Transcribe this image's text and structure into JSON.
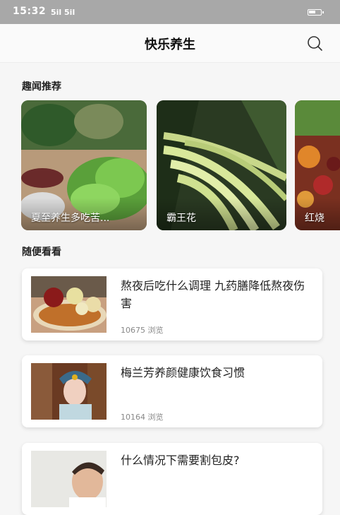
{
  "status_bar": {
    "time": "15:32",
    "signal": "5il 5il"
  },
  "header": {
    "title": "快乐养生"
  },
  "section_featured": {
    "title": "趣闻推荐"
  },
  "featured": [
    {
      "label": "夏至养生多吃苦..."
    },
    {
      "label": "霸王花"
    },
    {
      "label": "红烧"
    }
  ],
  "section_browse": {
    "title": "随便看看"
  },
  "articles": [
    {
      "title": "熬夜后吃什么调理 九药膳降低熬夜伤害",
      "views": "10675 浏览"
    },
    {
      "title": "梅兰芳养颜健康饮食习惯",
      "views": "10164 浏览"
    },
    {
      "title": "什么情况下需要割包皮?",
      "views": ""
    }
  ]
}
